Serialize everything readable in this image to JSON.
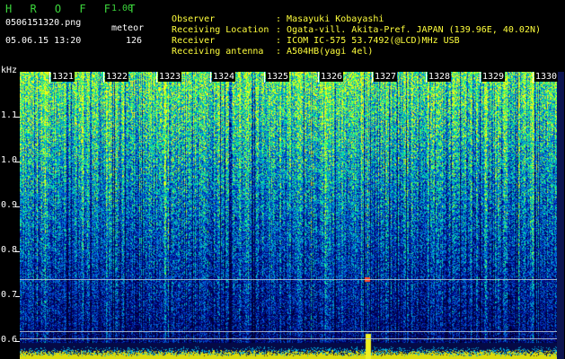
{
  "header": {
    "app_title": "H R O F F T",
    "app_version": "1.00",
    "file_name": "0506151320.png",
    "mode": "meteor",
    "datetime": "05.06.15 13:20",
    "count": "126"
  },
  "metadata": [
    {
      "key": "Observer",
      "sep": ":",
      "value": "Masayuki Kobayashi"
    },
    {
      "key": "Receiving Location",
      "sep": ":",
      "value": "Ogata-vill. Akita-Pref. JAPAN (139.96E, 40.02N)"
    },
    {
      "key": "Receiver",
      "sep": ":",
      "value": "ICOM IC-575 53.7492(@LCD)MHz USB"
    },
    {
      "key": "Receiving antenna",
      "sep": ":",
      "value": "A504HB(yagi 4el)"
    }
  ],
  "y_axis": {
    "unit": "kHz",
    "ticks": [
      "1.1",
      "1.0",
      "0.9",
      "0.8",
      "0.7",
      "0.6"
    ]
  },
  "x_axis": {
    "ticks": [
      "1321",
      "1322",
      "1323",
      "1324",
      "1325",
      "1326",
      "1327",
      "1328",
      "1329",
      "1330"
    ]
  },
  "colors": {
    "title_green": "#3cd63c",
    "meta_yellow": "#ffff3c",
    "background": "#000000"
  }
}
